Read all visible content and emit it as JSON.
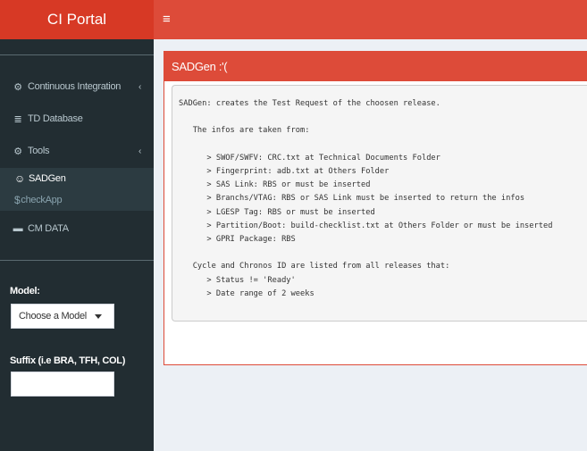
{
  "header": {
    "logo": "CI Portal",
    "menu_icon": "≡"
  },
  "sidebar": {
    "items": [
      {
        "icon": "gauge-icon",
        "glyph": "⚙",
        "label": "Continuous Integration",
        "chevron": "‹"
      },
      {
        "icon": "database-icon",
        "glyph": "≣",
        "label": "TD Database"
      },
      {
        "icon": "cogs-icon",
        "glyph": "⚙",
        "label": "Tools",
        "chevron": "‹"
      },
      {
        "icon": "table-icon",
        "glyph": "▬",
        "label": "CM DATA"
      }
    ],
    "subitems": [
      {
        "icon": "smile-icon",
        "glyph": "☺",
        "label": "SADGen"
      },
      {
        "icon": "dollar-icon",
        "glyph": "$",
        "label": "checkApp"
      }
    ],
    "model_label": "Model:",
    "model_select": "Choose a Model",
    "suffix_label": "Suffix (i.e BRA, TFH, COL)",
    "suffix_value": ""
  },
  "main": {
    "box_title": "SADGen :'(",
    "description": [
      "SADGen: creates the Test Request of the choosen release.",
      "",
      "   The infos are taken from:",
      "",
      "      > SWOF/SWFV: CRC.txt at Technical Documents Folder",
      "      > Fingerprint: adb.txt at Others Folder",
      "      > SAS Link: RBS or must be inserted",
      "      > Branchs/VTAG: RBS or SAS Link must be inserted to return the infos",
      "      > LGESP Tag: RBS or must be inserted",
      "      > Partition/Boot: build-checklist.txt at Others Folder or must be inserted",
      "      > GPRI Package: RBS",
      "",
      "   Cycle and Chronos ID are listed from all releases that:",
      "      > Status != 'Ready'",
      "      > Date range of 2 weeks"
    ]
  },
  "colors": {
    "header": "#dd4b39",
    "logo": "#d73925",
    "sidebar": "#222d32",
    "background": "#ecf0f5"
  }
}
